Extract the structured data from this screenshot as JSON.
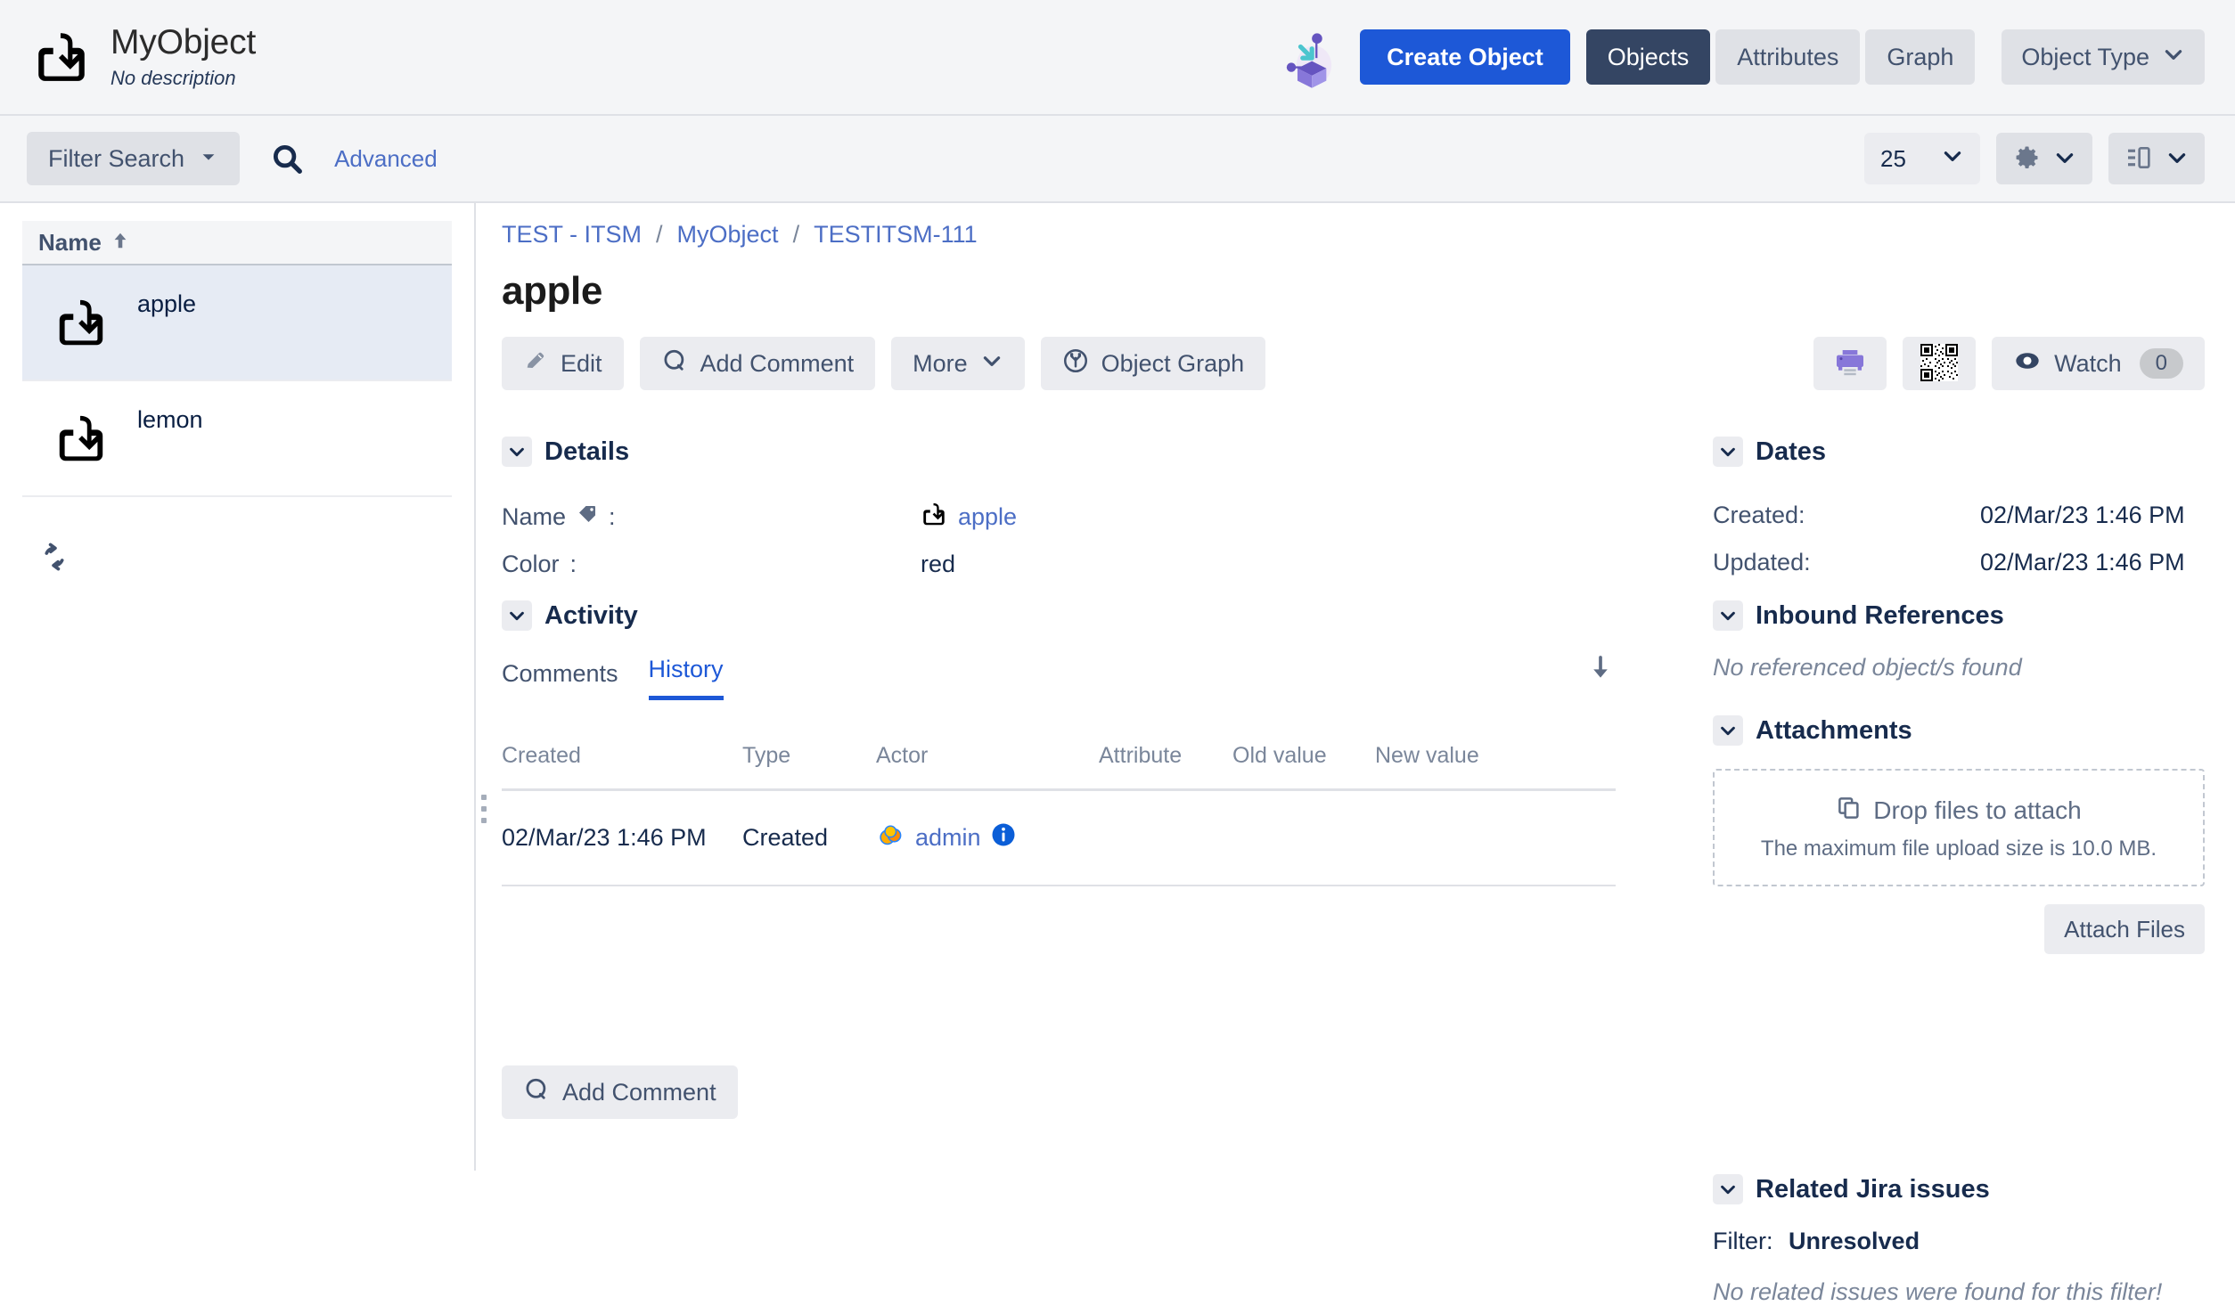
{
  "header": {
    "brand_icon": "object-import-icon",
    "title": "MyObject",
    "description": "No description",
    "illustration_icon": "object-box-illustration-icon",
    "create_button": "Create Object",
    "tabs": [
      {
        "label": "Objects",
        "active": true
      },
      {
        "label": "Attributes",
        "active": false
      },
      {
        "label": "Graph",
        "active": false
      }
    ],
    "object_type_dropdown": "Object Type"
  },
  "toolbar": {
    "filter_search": "Filter Search",
    "search_icon": "search-icon",
    "advanced_link": "Advanced",
    "page_size": "25",
    "settings_icon": "gear-icon",
    "layout_icon": "panel-layout-icon"
  },
  "sidebar": {
    "column_header": "Name",
    "sort_direction": "ascending",
    "items": [
      {
        "label": "apple",
        "selected": true
      },
      {
        "label": "lemon",
        "selected": false
      }
    ],
    "refresh_icon": "refresh-icon"
  },
  "main": {
    "breadcrumb": [
      "TEST - ITSM",
      "MyObject",
      "TESTITSM-111"
    ],
    "breadcrumb_separator": "/",
    "page_title": "apple",
    "actions": [
      {
        "label": "Edit",
        "icon": "pencil-icon"
      },
      {
        "label": "Add Comment",
        "icon": "comment-icon"
      },
      {
        "label": "More",
        "icon": "chevron-down-icon"
      },
      {
        "label": "Object Graph",
        "icon": "object-graph-icon"
      }
    ],
    "actions_right": {
      "print_icon": "printer-icon",
      "qr_icon": "qr-code-icon",
      "watch_label": "Watch",
      "watch_icon": "eye-icon",
      "watch_count": "0"
    },
    "details": {
      "title": "Details",
      "rows": [
        {
          "label": "Name",
          "label_icon": "tag-icon",
          "value": "apple",
          "value_icon": "object-import-icon",
          "is_link": true
        },
        {
          "label": "Color",
          "value": "red",
          "is_link": false
        }
      ]
    },
    "activity": {
      "title": "Activity",
      "tabs": [
        {
          "label": "Comments",
          "active": false
        },
        {
          "label": "History",
          "active": true
        }
      ],
      "sort_icon": "sort-descending-arrow-icon",
      "table": {
        "columns": [
          "Created",
          "Type",
          "Actor",
          "Attribute",
          "Old value",
          "New value"
        ],
        "rows": [
          {
            "created": "02/Mar/23 1:46 PM",
            "type": "Created",
            "actor": "admin",
            "actor_avatar": "admin-avatar-icon",
            "actor_info_icon": "info-icon",
            "attribute": "",
            "old_value": "",
            "new_value": ""
          }
        ]
      },
      "add_comment_button": "Add Comment"
    }
  },
  "right_panel": {
    "dates": {
      "title": "Dates",
      "rows": [
        {
          "label": "Created:",
          "value": "02/Mar/23 1:46 PM"
        },
        {
          "label": "Updated:",
          "value": "02/Mar/23 1:46 PM"
        }
      ]
    },
    "inbound_references": {
      "title": "Inbound References",
      "empty_message": "No referenced object/s found"
    },
    "attachments": {
      "title": "Attachments",
      "drop_icon": "copy-files-icon",
      "drop_label": "Drop files to attach",
      "max_size_note": "The maximum file upload size is 10.0 MB.",
      "attach_button": "Attach Files"
    },
    "related_jira": {
      "title": "Related Jira issues",
      "filter_label": "Filter:",
      "filter_value": "Unresolved",
      "empty_message": "No related issues were found for this filter!"
    }
  },
  "colors": {
    "accent_blue": "#1D58D7",
    "link_blue": "#4C6EC5",
    "dark_navy": "#344563",
    "chrome_bg": "#F4F5F7",
    "button_bg": "#EBECF0",
    "border": "#DFE1E6",
    "selected_row": "#E6EBF4",
    "purple": "#8777D9",
    "text": "#172B4D",
    "muted_text": "#7A869A"
  }
}
